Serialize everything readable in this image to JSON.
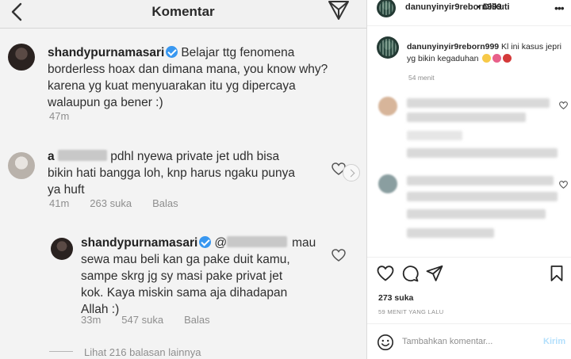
{
  "embedded": {
    "header_title": "Komentar",
    "comments": [
      {
        "username": "shandypurnamasari",
        "text_lines": [
          "Belajar ttg fenomena",
          "borderless hoax dan dimana mana, you know why?",
          "karena yg kuat menyuarakan itu yg dipercaya",
          "walaupun ga bener :)"
        ],
        "time": "47m"
      },
      {
        "username_prefix": "a",
        "text_lines": [
          "pdhl nyewa private jet udh bisa",
          "bikin hati bangga loh, knp harus ngaku punya",
          "ya huft"
        ],
        "time": "41m",
        "likes": "263 suka",
        "reply": "Balas"
      },
      {
        "username": "shandypurnamasari",
        "mention_prefix": "@",
        "text_lines": [
          "mau",
          "sewa mau beli kan ga pake duit kamu,",
          "sampe skrg jg sy masi pake privat jet",
          "kok. Kaya miskin sama aja dihadapan",
          "Allah :)"
        ],
        "time": "33m",
        "likes": "547 suka",
        "reply": "Balas"
      }
    ],
    "more_replies": "Lihat 216 balasan lainnya"
  },
  "panel": {
    "username": "danunyinyir9reborn999",
    "separator": "•",
    "follow_label": "Diikuti",
    "more_icon": "•••",
    "caption_user": "danunyinyir9reborn999",
    "caption_text": "Kl ini kasus jepri yg bikin kegaduhan",
    "caption_time": "54 menit",
    "likes": "273 suka",
    "posted_ago": "59 MENIT YANG LALU",
    "comment_placeholder": "Tambahkan komentar...",
    "post_label": "Kirim"
  }
}
